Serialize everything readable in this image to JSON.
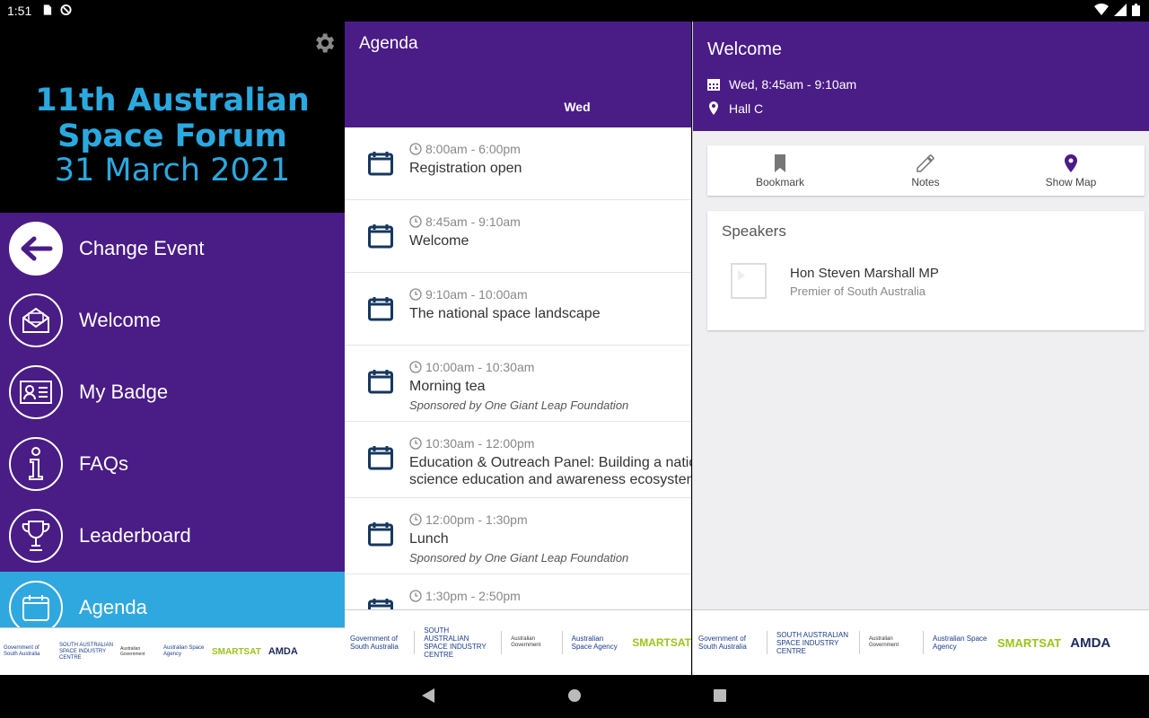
{
  "status_bar": {
    "time": "1:51"
  },
  "drawer": {
    "banner": {
      "line1": "11th Australian",
      "line2": "Space Forum",
      "line3": "31 March 2021"
    },
    "menu": [
      {
        "label": "Change Event",
        "icon": "arrow-left-icon"
      },
      {
        "label": "Welcome",
        "icon": "envelope-icon"
      },
      {
        "label": "My Badge",
        "icon": "badge-icon"
      },
      {
        "label": "FAQs",
        "icon": "info-icon"
      },
      {
        "label": "Leaderboard",
        "icon": "trophy-icon"
      },
      {
        "label": "Agenda",
        "icon": "calendar-icon",
        "active": true
      }
    ]
  },
  "agenda": {
    "title": "Agenda",
    "tab": "Wed",
    "sessions": [
      {
        "time": "8:00am - 6:00pm",
        "name": "Registration open"
      },
      {
        "time": "8:45am - 9:10am",
        "name": "Welcome"
      },
      {
        "time": "9:10am - 10:00am",
        "name": "The national space landscape"
      },
      {
        "time": "10:00am - 10:30am",
        "name": "Morning tea",
        "sponsor": "Sponsored by One Giant Leap Foundation"
      },
      {
        "time": "10:30am - 12:00pm",
        "name": "Education & Outreach Panel: Building a natio",
        "name2": "science education and awareness ecosystem"
      },
      {
        "time": "12:00pm - 1:30pm",
        "name": "Lunch",
        "sponsor": "Sponsored by One Giant Leap Foundation"
      },
      {
        "time": "1:30pm - 2:50pm",
        "name": ""
      }
    ]
  },
  "detail": {
    "title": "Welcome",
    "datetime": "Wed, 8:45am - 9:10am",
    "location": "Hall C",
    "actions": {
      "bookmark": "Bookmark",
      "notes": "Notes",
      "map": "Show Map"
    },
    "speakers_header": "Speakers",
    "speaker": {
      "name": "Hon Steven Marshall MP",
      "title": "Premier of South Australia"
    }
  },
  "sponsors": {
    "gov_sa": "Government of South Australia",
    "sasic": "SOUTH AUSTRALIAN SPACE INDUSTRY CENTRE",
    "aus_gov": "Australian Government",
    "asa": "Australian Space Agency",
    "smartsat": "SMARTSAT",
    "amda": "AMDA"
  },
  "colors": {
    "purple": "#4a1c86",
    "active_blue": "#2fa8df",
    "banner_text": "#2aa9e0"
  }
}
